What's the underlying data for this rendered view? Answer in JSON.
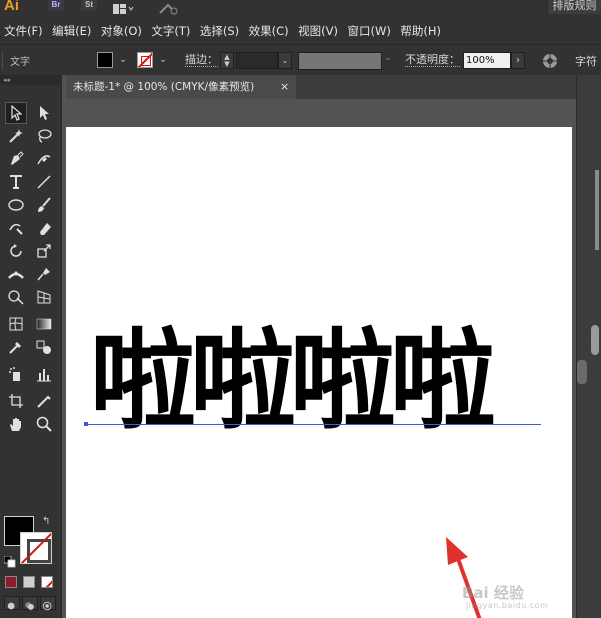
{
  "app": {
    "logo": "Ai",
    "bridge": "Br",
    "stock": "St",
    "workspace": "排版规则"
  },
  "menu": [
    "文件(F)",
    "编辑(E)",
    "对象(O)",
    "文字(T)",
    "选择(S)",
    "效果(C)",
    "视图(V)",
    "窗口(W)",
    "帮助(H)"
  ],
  "control": {
    "selection_label": "文字",
    "stroke_label": "描边：",
    "opacity_label": "不透明度：",
    "opacity_value": "100%",
    "character_label": "字符"
  },
  "document": {
    "tab_title": "未标题-1* @ 100% (CMYK/像素预览)",
    "close_glyph": "×",
    "text_content": "啦啦啦啦"
  },
  "watermark": {
    "main": "Bai 经验",
    "sub": "jingyan.baidu.com"
  },
  "colors": {
    "fill": "#000000",
    "stroke": "none",
    "arrow": "#e0312c",
    "baseline": "#3f5bd9"
  }
}
